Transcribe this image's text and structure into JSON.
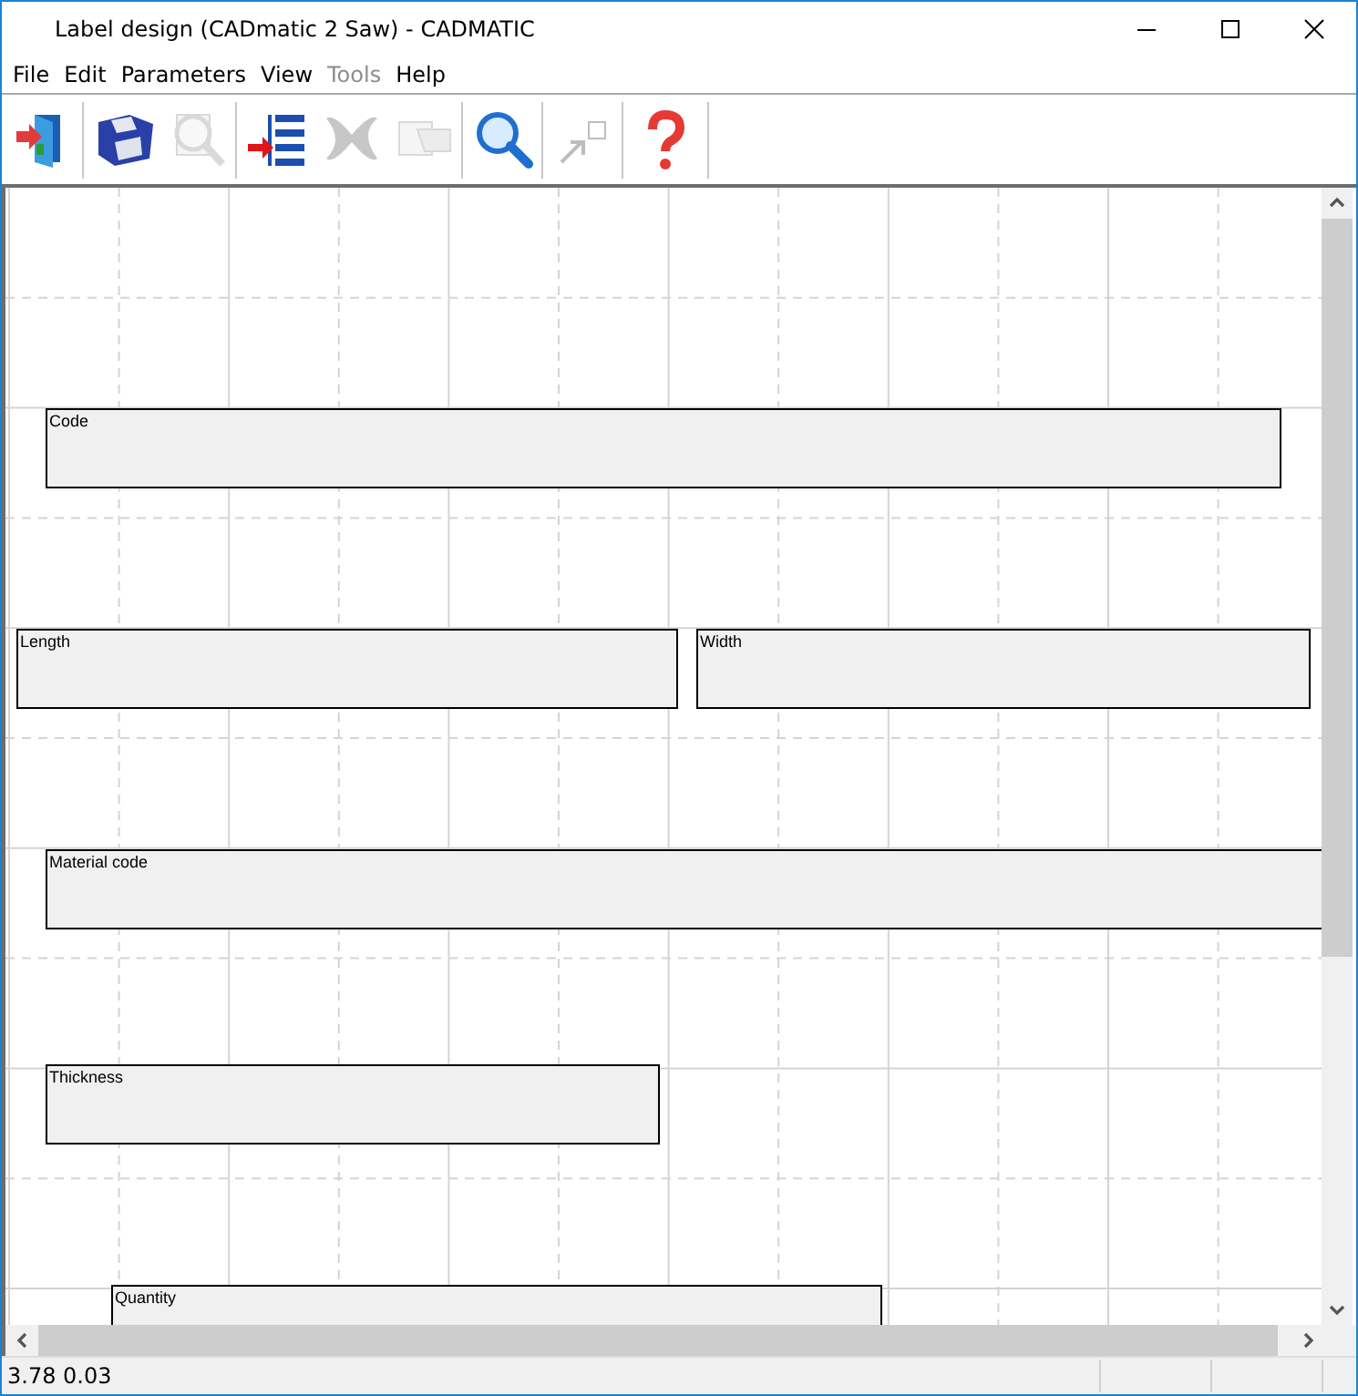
{
  "window": {
    "title": "Label design (CADmatic 2 Saw) - CADMATIC"
  },
  "menu": [
    {
      "label": "File",
      "disabled": false
    },
    {
      "label": "Edit",
      "disabled": false
    },
    {
      "label": "Parameters",
      "disabled": false
    },
    {
      "label": "View",
      "disabled": false
    },
    {
      "label": "Tools",
      "disabled": true
    },
    {
      "label": "Help",
      "disabled": false
    }
  ],
  "toolbar": [
    {
      "kind": "exit",
      "disabled": false,
      "group_start": false
    },
    {
      "kind": "save",
      "disabled": false,
      "group_start": true
    },
    {
      "kind": "preview",
      "disabled": true,
      "group_start": false
    },
    {
      "kind": "insert",
      "disabled": false,
      "group_start": true
    },
    {
      "kind": "delete",
      "disabled": true,
      "group_start": false
    },
    {
      "kind": "properties",
      "disabled": true,
      "group_start": false
    },
    {
      "kind": "zoom",
      "disabled": false,
      "group_start": true
    },
    {
      "kind": "select",
      "disabled": true,
      "group_start": true
    },
    {
      "kind": "help",
      "disabled": false,
      "group_start": true
    }
  ],
  "canvas": {
    "fields": [
      {
        "label": "Code"
      },
      {
        "label": "Length"
      },
      {
        "label": "Width"
      },
      {
        "label": "Material code"
      },
      {
        "label": "Thickness"
      },
      {
        "label": "Quantity"
      }
    ]
  },
  "status_bar": {
    "coordinates": "3.78 0.03"
  }
}
